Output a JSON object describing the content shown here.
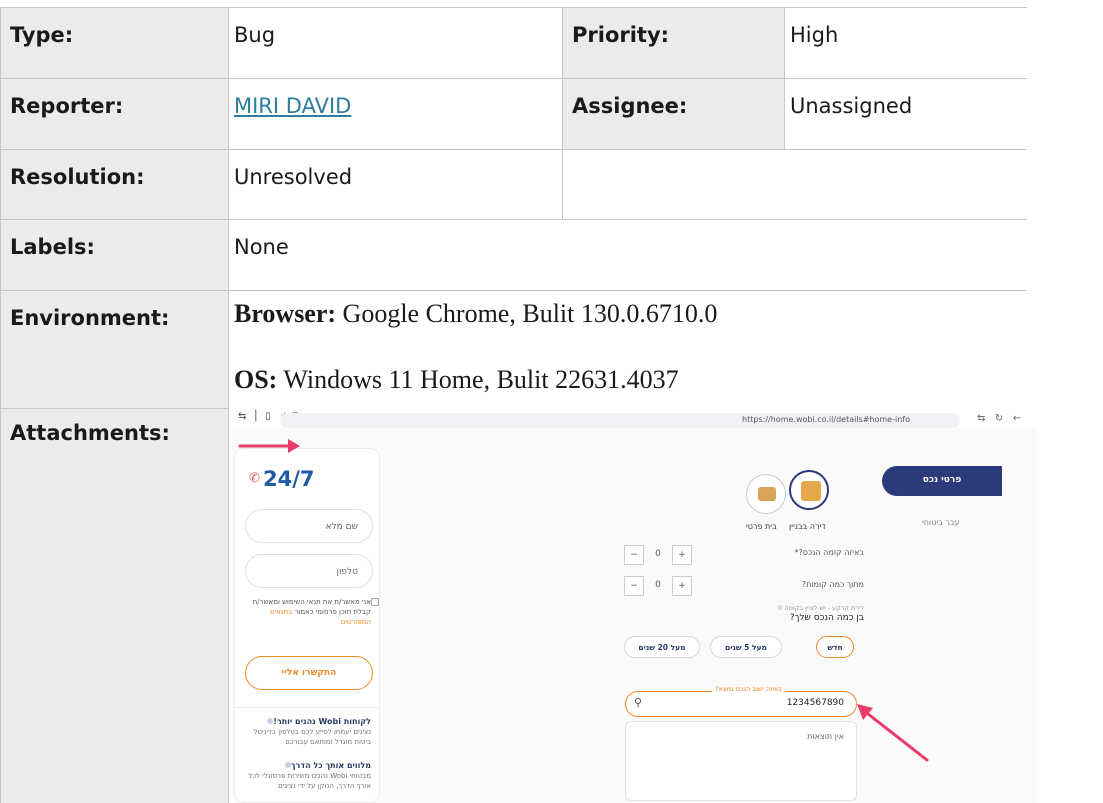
{
  "fields": {
    "type_label": "Type:",
    "type_value": "Bug",
    "priority_label": "Priority:",
    "priority_value": "High",
    "reporter_label": "Reporter:",
    "reporter_value": "MIRI DAVID",
    "assignee_label": "Assignee:",
    "assignee_value": "Unassigned",
    "resolution_label": "Resolution:",
    "resolution_value": "Unresolved",
    "labels_label": "Labels:",
    "labels_value": "None",
    "environment_label": "Environment:",
    "attachments_label": "Attachments:"
  },
  "environment": {
    "browser_label": "Browser:",
    "browser_value": " Google Chrome, Bulit 130.0.6710.0",
    "os_label": "OS:",
    "os_value": " Windows 11 Home, Bulit 22631.4037"
  },
  "colors": {
    "label_bg": "#ebebeb",
    "link": "#2e7d9c",
    "arrow": "#e83c6a",
    "brand_navy": "#2b3a7a",
    "brand_orange": "#ee8a2a"
  },
  "attachment": {
    "url": "https://home.wobi.co.il/details#home-info",
    "phone": "24/7",
    "name_placeholder": "שם מלא",
    "phone_placeholder": "טלפון",
    "consent_text": "אני מאשר/ת את תנאי השימוש ומאשר/ת קבלת תוכן פרסומי כאמור",
    "consent_link": "בתנאים המפורטים",
    "contact_button": "התקשרו אליי",
    "perk1_title": "לקוחות Wobi נהנים יותר!",
    "perk1_text": "נציגים יעמחו לסייע לכם בטלפון בדיגיטל ביטוח מוגדל ומותאם עבורכם",
    "perk2_title": "מלווים אותך כל הדרך",
    "perk2_text": "מבטוחי Wobi נהנים משירות פרסונלי לכל אורך הדרך, הנוקן על ידי נציגים",
    "step_button": "פרטי נכס",
    "step_sub": "עבר ביטוחי",
    "option_apartment": "דירה בבניין",
    "option_house": "בית פרטי",
    "q_floor": "באיזה קומה הנכס?*",
    "floor_value": "0",
    "q_floors_total": "מתוך כמה קומות?",
    "q_age_hint": "דירת קרקע - יש לציין בקומה 0",
    "q_age": "בן כמה הנכס שלך?",
    "age_new": "חדש",
    "age_5": "מעל 5 שנים",
    "age_20": "מעל 20 שנים",
    "search_legend": "באיזה ישוב הנכס נמצא?",
    "search_value": "1234567890",
    "no_results": "אין תוצאות"
  }
}
